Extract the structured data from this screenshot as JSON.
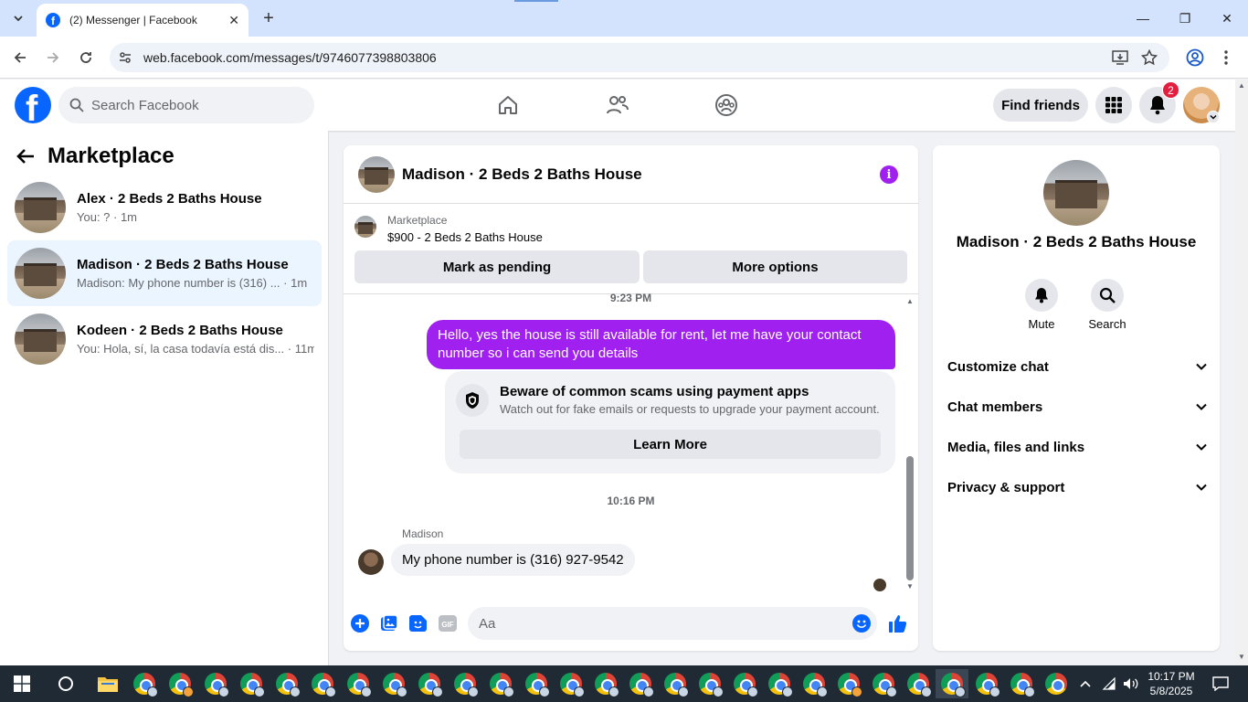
{
  "browser": {
    "tab_title": "(2) Messenger | Facebook",
    "url": "web.facebook.com/messages/t/9746077398803806"
  },
  "fbnav": {
    "search_placeholder": "Search Facebook",
    "find_friends": "Find friends",
    "notification_count": "2"
  },
  "sidebar": {
    "title": "Marketplace",
    "conversations": [
      {
        "name": "Alex · 2 Beds 2 Baths House",
        "preview": "You: ? · 1m"
      },
      {
        "name": "Madison · 2 Beds 2 Baths House",
        "preview": "Madison: My phone number is (316) ... · 1m"
      },
      {
        "name": "Kodeen · 2 Beds 2 Baths House",
        "preview": "You: Hola, sí, la casa todavía está dis... · 11m"
      }
    ]
  },
  "chat": {
    "title": "Madison · 2 Beds 2 Baths House",
    "marketplace_label": "Marketplace",
    "listing": "$900 - 2 Beds 2 Baths House",
    "mark_pending": "Mark as pending",
    "more_options": "More options",
    "time1": "9:23 PM",
    "outgoing_message": "Hello, yes the house is still available for rent, let me have your contact number so i can send you  details",
    "scam_title": "Beware of common scams using payment apps",
    "scam_sub": "Watch out for fake emails or requests to upgrade your payment account.",
    "learn_more": "Learn More",
    "time2": "10:16 PM",
    "sender": "Madison",
    "incoming_message": "My phone number is (316) 927-9542",
    "input_placeholder": "Aa"
  },
  "info": {
    "name": "Madison · 2 Beds 2 Baths House",
    "mute": "Mute",
    "search": "Search",
    "sections": [
      "Customize chat",
      "Chat members",
      "Media, files and links",
      "Privacy & support"
    ]
  },
  "taskbar": {
    "time": "10:17 PM",
    "date": "5/8/2025"
  },
  "colors": {
    "fb_blue": "#0866ff",
    "accent_purple": "#a020f0",
    "badge_red": "#e41e3f"
  }
}
